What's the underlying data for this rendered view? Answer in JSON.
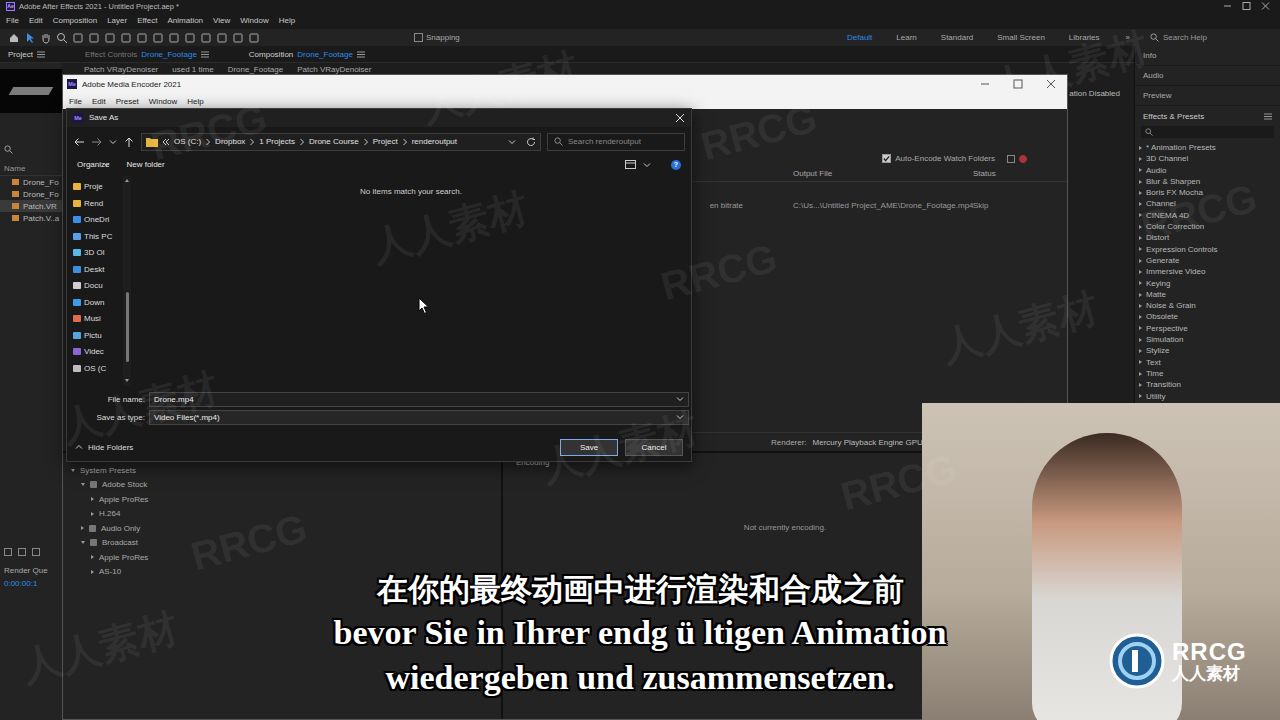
{
  "ae": {
    "title": "Adobe After Effects 2021 - Untitled Project.aep *",
    "app_badge": "Ae",
    "menu": [
      "File",
      "Edit",
      "Composition",
      "Layer",
      "Effect",
      "Animation",
      "View",
      "Window",
      "Help"
    ],
    "snapping": {
      "label": "Snapping",
      "checked": false
    },
    "workspaces": [
      {
        "label": "Default",
        "selected": true
      },
      {
        "label": "Learn",
        "selected": false
      },
      {
        "label": "Standard",
        "selected": false
      },
      {
        "label": "Small Screen",
        "selected": false
      },
      {
        "label": "Libraries",
        "selected": false
      }
    ],
    "workspaces_more": "»",
    "search_placeholder": "Search Help",
    "tabs": [
      {
        "label": "Project",
        "detail": "",
        "selected": true
      },
      {
        "label": "Effect Controls",
        "detail": "Drone_Footage",
        "selected": false
      },
      {
        "label": "Composition",
        "detail": "Drone_Footage",
        "selected": true
      }
    ],
    "subtabs": [
      "Patch VRayDenoiser",
      "used 1 time",
      "Drone_Footage",
      "Patch VRayDenoiser"
    ],
    "status_fragment": "ation Disabled",
    "project": {
      "header": "Name",
      "items": [
        {
          "name": "Drone_Fo",
          "selected": false
        },
        {
          "name": "Drone_Fo",
          "selected": false
        },
        {
          "name": "Patch.VR",
          "selected": true
        },
        {
          "name": "Patch.V..a",
          "selected": false
        }
      ]
    },
    "render_queue": {
      "label": "Render Que",
      "timecode": "0:00:00:1"
    },
    "side_panels": [
      "Info",
      "Audio",
      "Preview"
    ],
    "effects": {
      "title": "Effects & Presets",
      "items": [
        "* Animation Presets",
        "3D Channel",
        "Audio",
        "Blur & Sharpen",
        "Boris FX Mocha",
        "Channel",
        "CINEMA 4D",
        "Color Correction",
        "Distort",
        "Expression Controls",
        "Generate",
        "Immersive Video",
        "Keying",
        "Matte",
        "Noise & Grain",
        "Obsolete",
        "Perspective",
        "Simulation",
        "Stylize",
        "Text",
        "Time",
        "Transition",
        "Utility"
      ]
    }
  },
  "ame": {
    "title": "Adobe Media Encoder 2021",
    "app_badge": "Me",
    "menu": [
      "File",
      "Edit",
      "Preset",
      "Window",
      "Help"
    ],
    "watch_folders": {
      "label": "Auto-Encode Watch Folders",
      "checked": true
    },
    "queue_columns": [
      "Output File",
      "Status"
    ],
    "queue_row": {
      "preset": "en bitrate",
      "output": "C:\\Us...\\Untitled Project_AME\\Drone_Footage.mp4",
      "status": "Skip"
    },
    "renderer": {
      "label": "Renderer:",
      "value": "Mercury Playback Engine GPU Acc"
    },
    "encoding": {
      "tab": "Encoding",
      "message": "Not currently encoding."
    },
    "presets": [
      {
        "label": "System Presets",
        "expanded": true,
        "children": [
          {
            "label": "Adobe Stock",
            "expanded": true,
            "children": [
              {
                "label": "Apple ProRes",
                "expanded": false
              },
              {
                "label": "H.264",
                "expanded": false
              }
            ]
          },
          {
            "label": "Audio Only",
            "expanded": false
          },
          {
            "label": "Broadcast",
            "expanded": true,
            "children": [
              {
                "label": "Apple ProRes",
                "expanded": false
              },
              {
                "label": "AS-10",
                "expanded": false
              }
            ]
          }
        ]
      }
    ]
  },
  "dialog": {
    "title": "Save As",
    "app_badge": "Me",
    "path": [
      "OS (C:)",
      "Dropbox",
      "1 Projects",
      "Drone Course",
      "Project",
      "renderoutput"
    ],
    "search_placeholder": "Search renderoutput",
    "organize": "Organize",
    "new_folder": "New folder",
    "help": "?",
    "sidebar": [
      {
        "label": "Proje",
        "color": "#e7b53d"
      },
      {
        "label": "Rend",
        "color": "#e7b53d"
      },
      {
        "label": "OneDri",
        "color": "#3a8ee6"
      },
      {
        "label": "This PC",
        "color": "#5aa0e8"
      },
      {
        "label": "3D Ol",
        "color": "#59b6e8"
      },
      {
        "label": "Deskt",
        "color": "#3d8fe0"
      },
      {
        "label": "Docu",
        "color": "#cfcfcf"
      },
      {
        "label": "Down",
        "color": "#3d9be8"
      },
      {
        "label": "Musi",
        "color": "#e06b4f"
      },
      {
        "label": "Pictu",
        "color": "#58a6e0"
      },
      {
        "label": "Videc",
        "color": "#8a67d8"
      },
      {
        "label": "OS (C",
        "color": "#bcbcbc"
      }
    ],
    "empty_message": "No items match your search.",
    "file_name": {
      "label": "File name:",
      "value": "Drone.mp4"
    },
    "save_type": {
      "label": "Save as type:",
      "value": "Video Files(*.mp4)"
    },
    "hide_folders": "Hide Folders",
    "buttons": [
      {
        "label": "Save",
        "default": true
      },
      {
        "label": "Cancel",
        "default": false
      }
    ]
  },
  "subtitles": [
    {
      "text": "在你的最终动画中进行渲染和合成之前",
      "kind": "zh"
    },
    {
      "text": "bevor Sie in Ihrer endg ü ltigen Animation",
      "kind": "de"
    },
    {
      "text": "wiedergeben und zusammensetzen.",
      "kind": "de"
    }
  ],
  "watermark": {
    "logo_mark": "RRCG",
    "logo_text": "人人素材",
    "tiles": [
      "RRCG",
      "人人素材"
    ]
  }
}
